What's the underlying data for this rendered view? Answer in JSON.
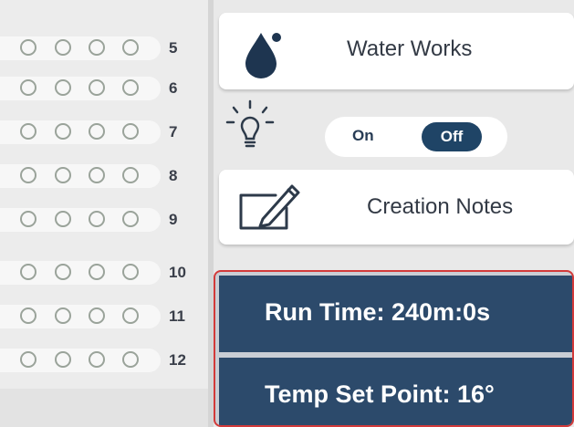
{
  "channels": [
    {
      "number": "5"
    },
    {
      "number": "6"
    },
    {
      "number": "7"
    },
    {
      "number": "8"
    },
    {
      "number": "9"
    },
    {
      "number": "10"
    },
    {
      "number": "11"
    },
    {
      "number": "12"
    }
  ],
  "water_works": {
    "label": "Water Works",
    "icon": "water-drop-icon"
  },
  "light_toggle": {
    "icon": "light-bulb-icon",
    "on_label": "On",
    "off_label": "Off",
    "selected": "Off"
  },
  "creation_notes": {
    "label": "Creation Notes",
    "icon": "note-edit-icon"
  },
  "status": {
    "run_time": "Run Time: 240m:0s",
    "temp_set_point": "Temp Set Point: 16°"
  },
  "colors": {
    "accent": "#2c4a6b",
    "highlight_border": "#d23a3a"
  }
}
